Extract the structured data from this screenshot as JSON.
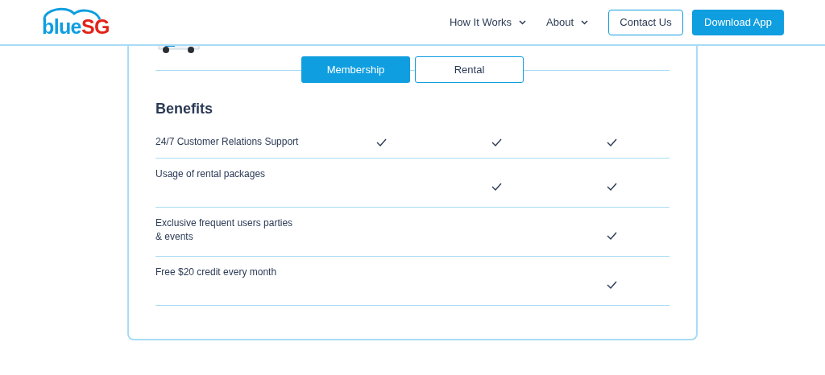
{
  "header": {
    "logo": {
      "primary": "blue",
      "accent": "SG"
    },
    "nav": [
      {
        "label": "How It Works",
        "dropdown": true
      },
      {
        "label": "About",
        "dropdown": true
      }
    ],
    "buttons": [
      {
        "label": "Contact Us",
        "kind": "outline"
      },
      {
        "label": "Download App",
        "kind": "filled"
      }
    ]
  },
  "plan_tabs": [
    {
      "label": "Membership",
      "selected": true
    },
    {
      "label": "Rental",
      "selected": false
    }
  ],
  "benefits": {
    "title": "Benefits",
    "rows": [
      {
        "label": "24/7 Customer Relations Support",
        "checks": [
          true,
          true,
          true
        ]
      },
      {
        "label": "Usage of rental packages",
        "checks": [
          false,
          true,
          true
        ]
      },
      {
        "label": "Exclusive frequent users parties & events",
        "checks": [
          false,
          false,
          true
        ]
      },
      {
        "label": "Free $20 credit every month",
        "checks": [
          false,
          false,
          true
        ]
      }
    ]
  }
}
